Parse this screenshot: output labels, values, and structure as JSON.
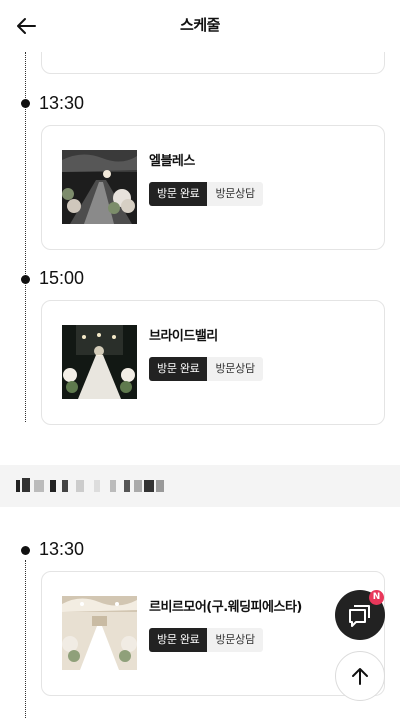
{
  "header": {
    "title": "스케줄",
    "back_icon": "arrow-left-icon"
  },
  "groups": [
    {
      "entries": [
        {
          "time": "13:30",
          "venue": "엘블레스",
          "tag_done": "방문 완료",
          "tag_consult": "방문상담"
        },
        {
          "time": "15:00",
          "venue": "브라이드밸리",
          "tag_done": "방문 완료",
          "tag_consult": "방문상담"
        }
      ]
    },
    {
      "date_label": "",
      "entries": [
        {
          "time": "13:30",
          "venue": "르비르모어(구.웨딩피에스타)",
          "tag_done": "방문 완료",
          "tag_consult": "방문상담"
        }
      ]
    }
  ],
  "floating": {
    "chat_icon": "chat-bubble-icon",
    "chat_badge": "N",
    "top_icon": "arrow-up-icon"
  },
  "colors": {
    "accent_dark": "#222222",
    "badge": "#e8375a",
    "tag_light": "#f1f1f1"
  }
}
